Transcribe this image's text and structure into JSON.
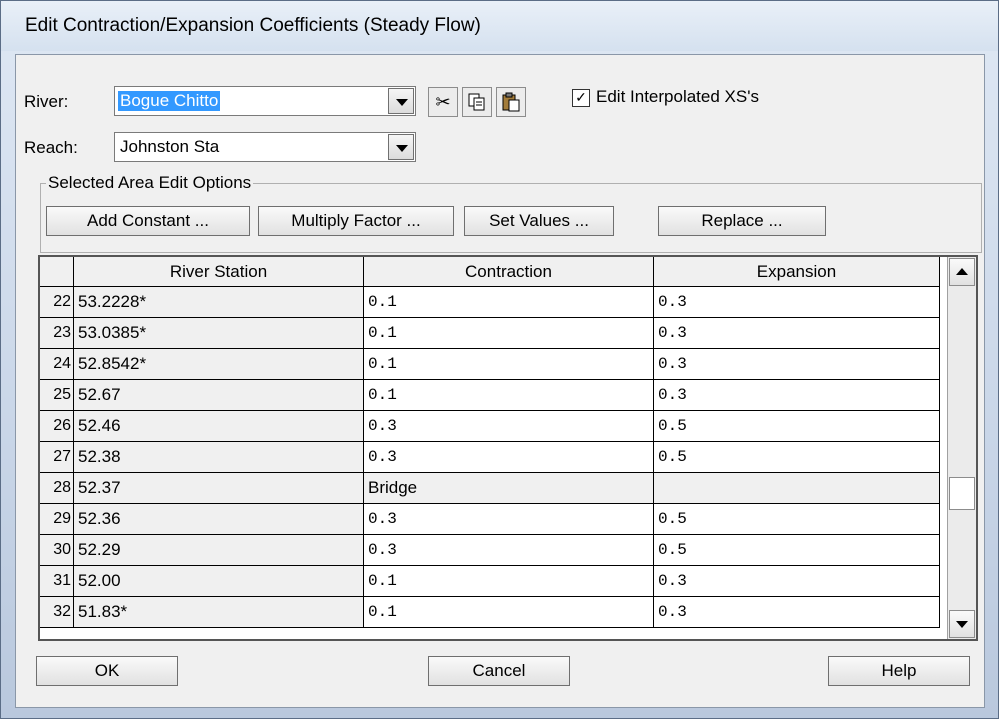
{
  "window": {
    "title": "Edit Contraction/Expansion Coefficients (Steady Flow)"
  },
  "river": {
    "label": "River:",
    "value": "Bogue Chitto"
  },
  "reach": {
    "label": "Reach:",
    "value": "Johnston Sta"
  },
  "toolbar": {
    "cut_icon": "scissors-icon",
    "copy_icon": "copy-icon",
    "paste_icon": "paste-icon",
    "edit_interp_checked": true,
    "edit_interp_label": "Edit Interpolated XS's"
  },
  "area_options": {
    "title": "Selected Area Edit Options",
    "add_constant": "Add Constant ...",
    "multiply_factor": "Multiply Factor ...",
    "set_values": "Set Values ...",
    "replace": "Replace ..."
  },
  "table": {
    "headers": [
      "River Station",
      "Contraction",
      "Expansion"
    ],
    "rows": [
      {
        "num": "22",
        "station": "53.2228*",
        "contraction": "0.1",
        "expansion": "0.3"
      },
      {
        "num": "23",
        "station": "53.0385*",
        "contraction": "0.1",
        "expansion": "0.3"
      },
      {
        "num": "24",
        "station": "52.8542*",
        "contraction": "0.1",
        "expansion": "0.3"
      },
      {
        "num": "25",
        "station": "52.67",
        "contraction": "0.1",
        "expansion": "0.3"
      },
      {
        "num": "26",
        "station": "52.46",
        "contraction": "0.3",
        "expansion": "0.5"
      },
      {
        "num": "27",
        "station": "52.38",
        "contraction": "0.3",
        "expansion": "0.5"
      },
      {
        "num": "28",
        "station": "52.37",
        "contraction": "Bridge",
        "expansion": ""
      },
      {
        "num": "29",
        "station": "52.36",
        "contraction": "0.3",
        "expansion": "0.5"
      },
      {
        "num": "30",
        "station": "52.29",
        "contraction": "0.3",
        "expansion": "0.5"
      },
      {
        "num": "31",
        "station": "52.00",
        "contraction": "0.1",
        "expansion": "0.3"
      },
      {
        "num": "32",
        "station": "51.83*",
        "contraction": "0.1",
        "expansion": "0.3"
      }
    ]
  },
  "buttons": {
    "ok": "OK",
    "cancel": "Cancel",
    "help": "Help"
  }
}
